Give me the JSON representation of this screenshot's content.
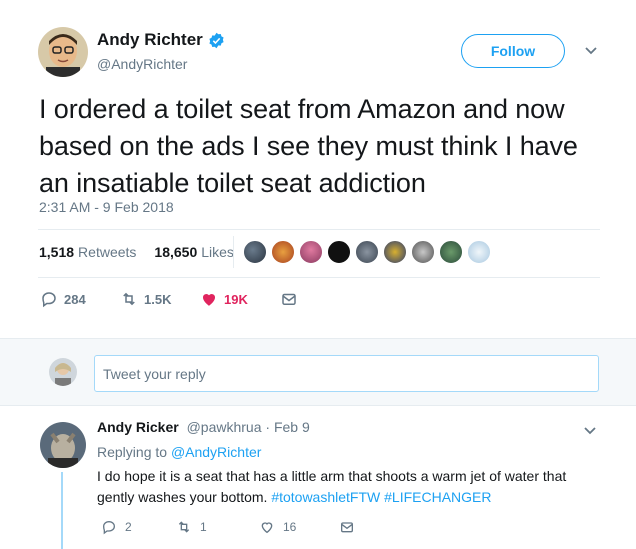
{
  "tweet": {
    "author_name": "Andy Richter",
    "author_handle": "@AndyRichter",
    "follow_label": "Follow",
    "text": "I ordered a toilet seat from Amazon and now based on the ads I see they must think I have an insatiable toilet seat addiction",
    "timestamp": "2:31 AM - 9 Feb 2018",
    "retweets_count": "1,518",
    "retweets_label": "Retweets",
    "likes_count": "18,650",
    "likes_label": "Likes",
    "actions": {
      "replies": "284",
      "retweets": "1.5K",
      "likes": "19K"
    }
  },
  "reply_box": {
    "placeholder": "Tweet your reply"
  },
  "reply": {
    "author_name": "Andy Ricker",
    "author_handle": "@pawkhrua",
    "date": "· Feb 9",
    "replying_prefix": "Replying to",
    "replying_to": "@AndyRichter",
    "text": "I do hope it is a seat that has a little arm that shoots a warm jet of water that gently washes your bottom.",
    "hashtag_1": "#totowashletFTW",
    "hashtag_2": "#LIFECHANGER",
    "actions": {
      "replies": "2",
      "retweets": "1",
      "likes": "16"
    }
  },
  "colors": {
    "accent": "#1da1f2",
    "like": "#e0245e",
    "muted": "#657786"
  }
}
